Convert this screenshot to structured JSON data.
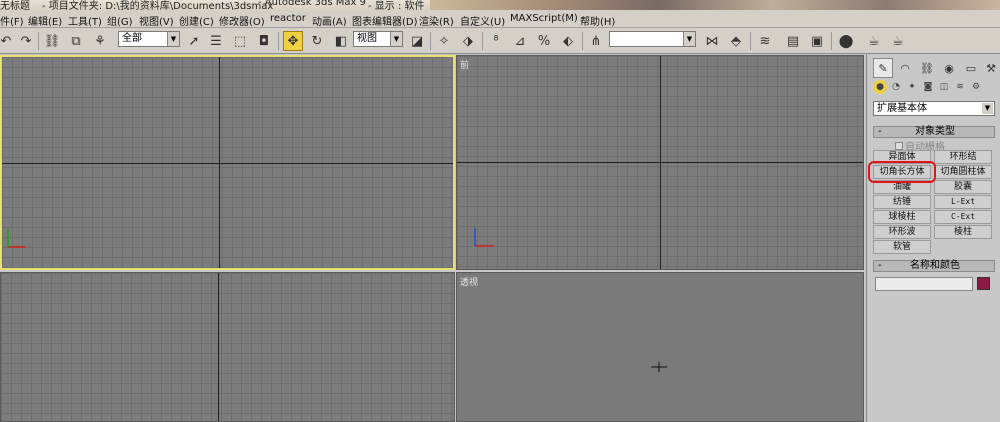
{
  "titlebar": {
    "app_name": "无标题",
    "project": "- 项目文件夹: D:\\我的资料库\\Documents\\3dsmax",
    "product": "- Autodesk 3ds Max 9",
    "display": "- 显示 : 软件"
  },
  "menu": [
    "件(F)",
    "编辑(E)",
    "工具(T)",
    "组(G)",
    "视图(V)",
    "创建(C)",
    "修改器(O)",
    "reactor",
    "动画(A)",
    "图表编辑器(D)",
    "渲染(R)",
    "自定义(U)",
    "MAXScript(M)",
    "帮助(H)"
  ],
  "toolbar": {
    "selection_filter": "全部",
    "ref_coord": "视图",
    "named_selection": ""
  },
  "viewports": {
    "top_left_label": "",
    "front_label": "前",
    "left_label": "",
    "perspective_label": "透视"
  },
  "panel": {
    "category_dropdown": "扩展基本体",
    "object_type_title": "对象类型",
    "autogrid_label": "自动栅格",
    "buttons": [
      {
        "left": "异面体",
        "right": "环形结"
      },
      {
        "left": "切角长方体",
        "right": "切角圆柱体"
      },
      {
        "left": "油罐",
        "right": "胶囊"
      },
      {
        "left": "纺锤",
        "right": "L-Ext"
      },
      {
        "left": "球棱柱",
        "right": "C-Ext"
      },
      {
        "left": "环形波",
        "right": "棱柱"
      },
      {
        "left": "软管",
        "right": ""
      }
    ],
    "name_color_title": "名称和颜色",
    "name_value": "",
    "swatch_color": "#8b1a44",
    "highlighted_button": "切角长方体",
    "highlight_color": "#e0141a"
  }
}
